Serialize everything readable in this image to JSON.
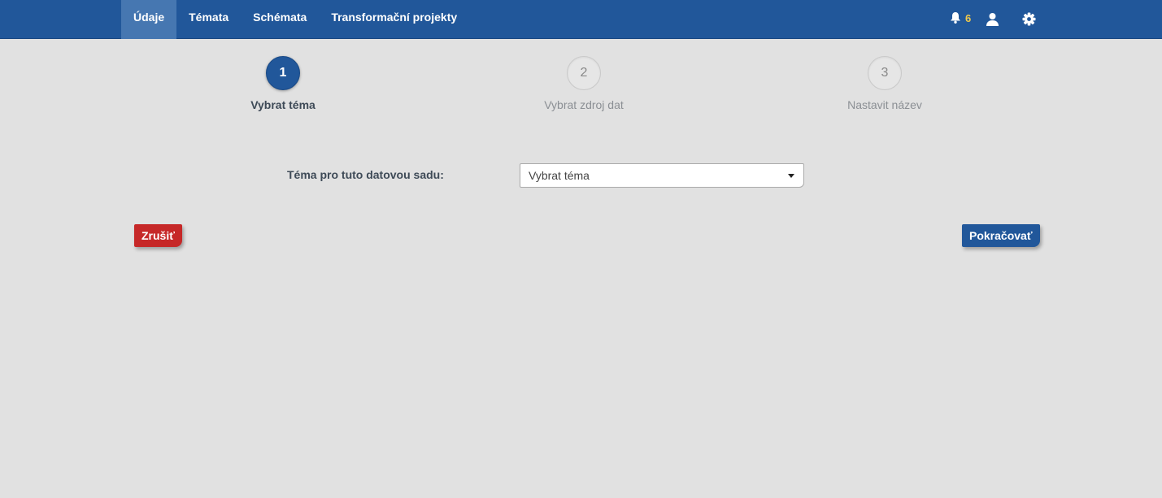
{
  "nav": {
    "items": [
      {
        "label": "Údaje",
        "active": true
      },
      {
        "label": "Témata",
        "active": false
      },
      {
        "label": "Schémata",
        "active": false
      },
      {
        "label": "Transformační projekty",
        "active": false
      }
    ],
    "notification_count": "6",
    "icons": [
      "bell-icon",
      "user-icon",
      "gear-icon"
    ],
    "notification_color": "#f1c94b"
  },
  "wizard": {
    "steps": [
      {
        "number": "1",
        "label": "Vybrat téma",
        "active": true
      },
      {
        "number": "2",
        "label": "Vybrat zdroj dat",
        "active": false
      },
      {
        "number": "3",
        "label": "Nastavit název",
        "active": false
      }
    ]
  },
  "form": {
    "theme_label": "Téma pro tuto datovou sadu:",
    "theme_select_value": "Vybrat téma"
  },
  "buttons": {
    "cancel": "Zrušiť",
    "continue": "Pokračovať"
  },
  "colors": {
    "brand": "#21579a",
    "danger": "#c62828",
    "background": "#e1e1e1"
  }
}
